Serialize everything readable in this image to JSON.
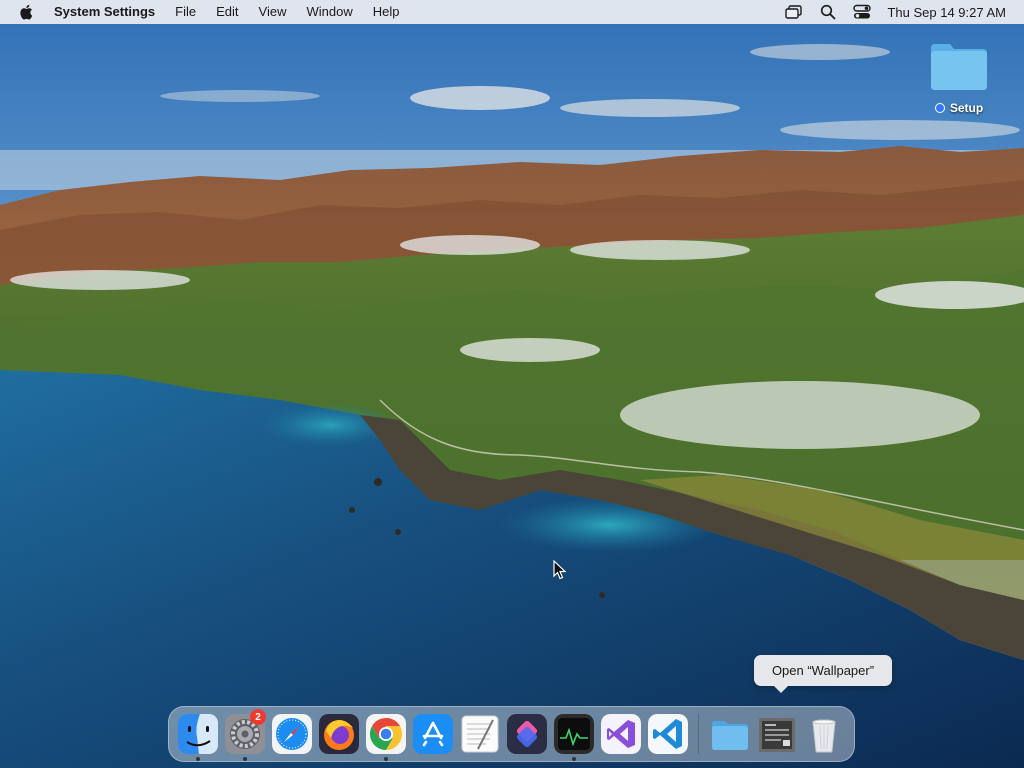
{
  "menubar": {
    "apple_icon": "apple-logo",
    "app_name": "System Settings",
    "menus": [
      "File",
      "Edit",
      "View",
      "Window",
      "Help"
    ],
    "status_icons": [
      "screen-mirroring-icon",
      "spotlight-search-icon",
      "control-center-icon"
    ],
    "clock": "Thu Sep 14  9:27 AM"
  },
  "desktop": {
    "items": [
      {
        "label": "Setup",
        "icon": "folder-icon",
        "tag_color": "#3478f6"
      }
    ]
  },
  "tooltip": {
    "text": "Open “Wallpaper”"
  },
  "dock": {
    "apps": [
      {
        "name": "Finder",
        "icon": "finder-icon",
        "running": true
      },
      {
        "name": "System Settings",
        "icon": "system-settings-icon",
        "running": true,
        "badge": "2"
      },
      {
        "name": "Safari",
        "icon": "safari-icon",
        "running": false
      },
      {
        "name": "Firefox",
        "icon": "firefox-icon",
        "running": false
      },
      {
        "name": "Google Chrome",
        "icon": "chrome-icon",
        "running": true
      },
      {
        "name": "App Store",
        "icon": "app-store-icon",
        "running": false
      },
      {
        "name": "TextEdit",
        "icon": "textedit-icon",
        "running": false
      },
      {
        "name": "Shortcuts",
        "icon": "shortcuts-icon",
        "running": false
      },
      {
        "name": "Activity Monitor",
        "icon": "activity-monitor-icon",
        "running": true
      },
      {
        "name": "Visual Studio",
        "icon": "visual-studio-icon",
        "running": false
      },
      {
        "name": "Visual Studio Code",
        "icon": "vscode-icon",
        "running": false
      }
    ],
    "stacks": [
      {
        "name": "Folder",
        "icon": "folder-stack-icon"
      },
      {
        "name": "Wallpaper",
        "icon": "wallpaper-stack-icon"
      },
      {
        "name": "Trash",
        "icon": "trash-icon"
      }
    ]
  },
  "colors": {
    "accent": "#3478f6",
    "badge": "#f03a2e",
    "menubar_bg": "#eceef2"
  }
}
